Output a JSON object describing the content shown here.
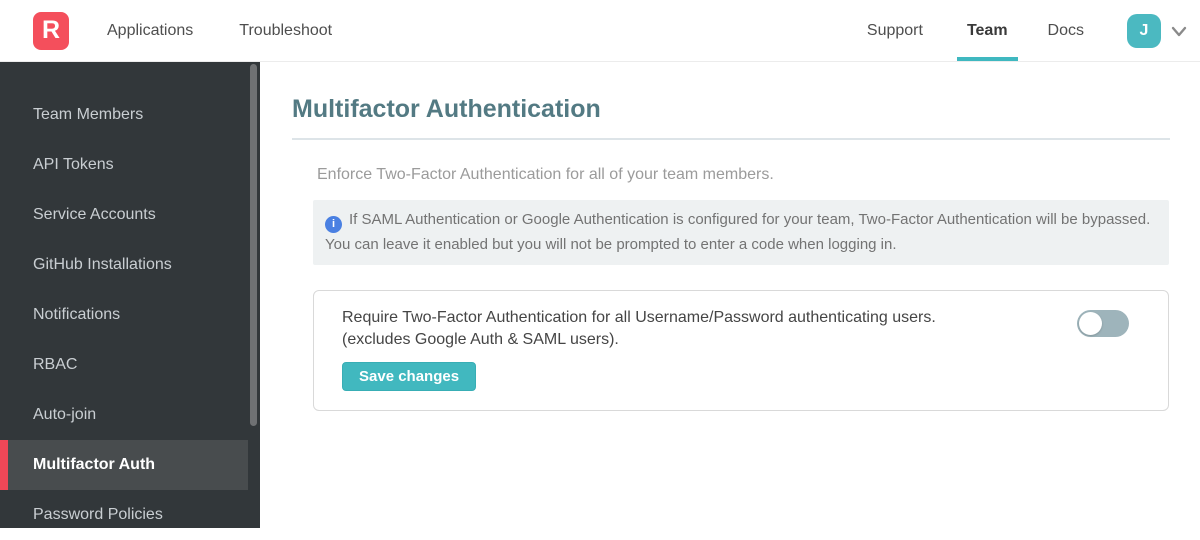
{
  "navbar": {
    "logo_letter": "R",
    "left_links": [
      {
        "label": "Applications"
      },
      {
        "label": "Troubleshoot"
      }
    ],
    "right_links": [
      {
        "label": "Support",
        "active": false
      },
      {
        "label": "Team",
        "active": true
      },
      {
        "label": "Docs",
        "active": false
      }
    ],
    "avatar_initial": "J"
  },
  "sidebar": {
    "items": [
      {
        "label": "Team Members",
        "active": false
      },
      {
        "label": "API Tokens",
        "active": false
      },
      {
        "label": "Service Accounts",
        "active": false
      },
      {
        "label": "GitHub Installations",
        "active": false
      },
      {
        "label": "Notifications",
        "active": false
      },
      {
        "label": "RBAC",
        "active": false
      },
      {
        "label": "Auto-join",
        "active": false
      },
      {
        "label": "Multifactor Auth",
        "active": true
      },
      {
        "label": "Password Policies",
        "active": false
      }
    ]
  },
  "main": {
    "title": "Multifactor Authentication",
    "description": "Enforce Two-Factor Authentication for all of your team members.",
    "info_note": "If SAML Authentication or Google Authentication is configured for your team, Two-Factor Authentication will be bypassed. You can leave it enabled but you will not be prompted to enter a code when logging in.",
    "setting": {
      "label_line1": "Require Two-Factor Authentication for all Username/Password authenticating users.",
      "label_line2": "(excludes Google Auth & SAML users).",
      "toggle_state": "off",
      "save_button_label": "Save changes"
    }
  },
  "icons": {
    "info_glyph": "i"
  },
  "colors": {
    "brand_red": "#f44f5c",
    "sidebar_active_border": "#ef4757",
    "accent_teal": "#41b8bf",
    "avatar_teal": "#4bb9c1",
    "heading_teal": "#537a83",
    "sidebar_bg": "#32373a",
    "sidebar_active_bg": "#484c4e",
    "info_icon_blue": "#4a80e2",
    "info_box_bg": "#eef1f2",
    "toggle_off_gray": "#9eb4bb"
  }
}
